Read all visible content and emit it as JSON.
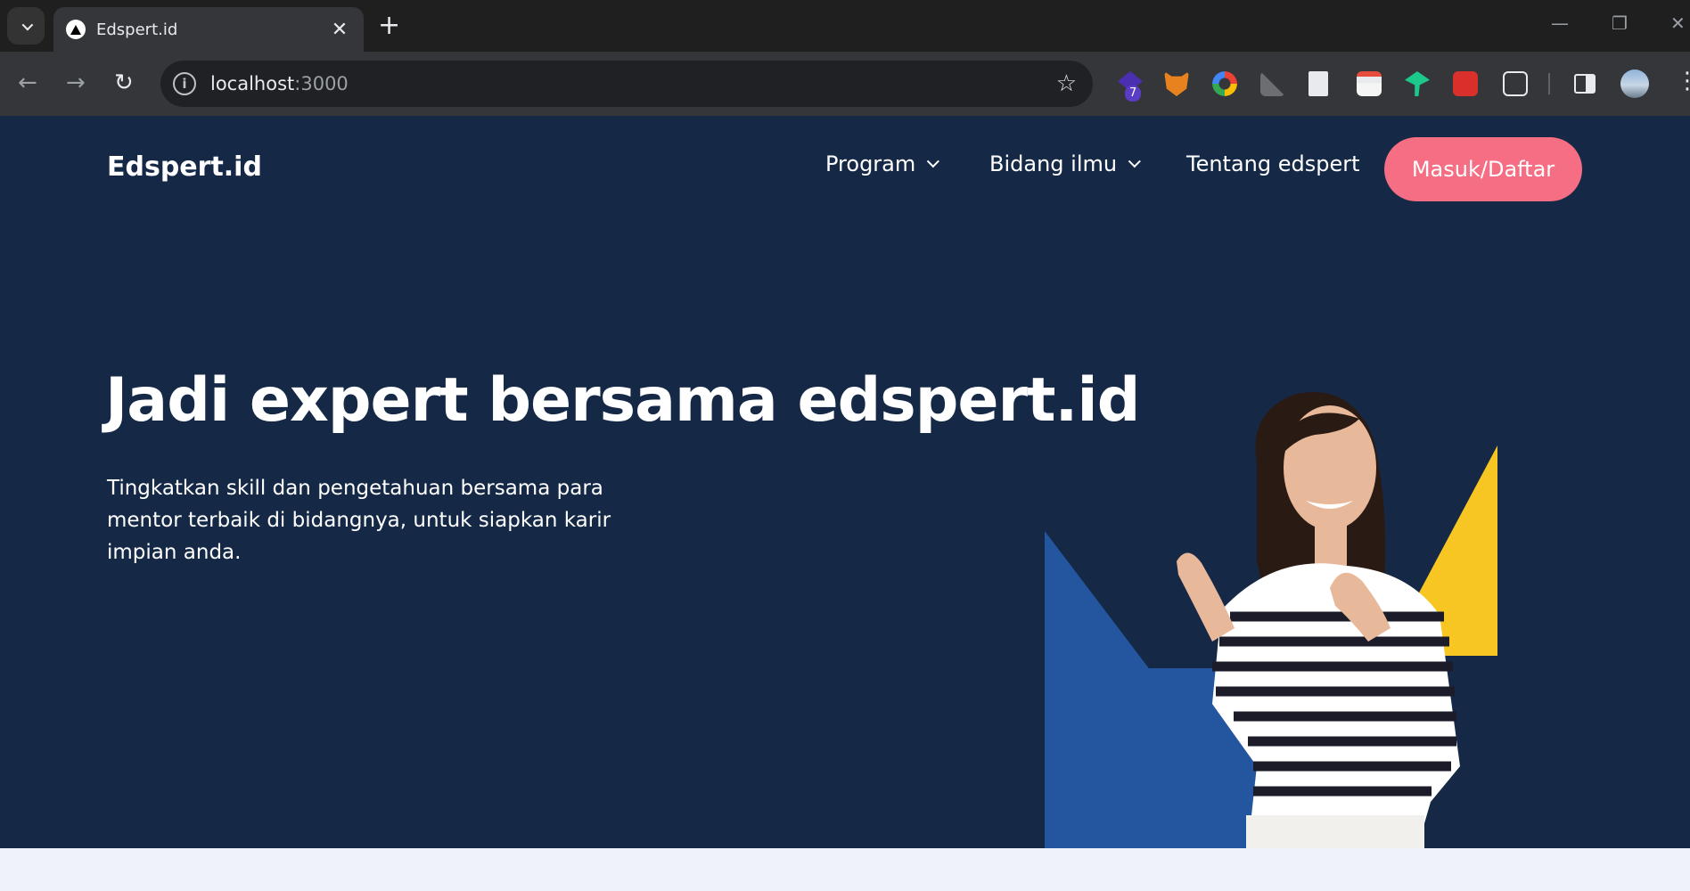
{
  "browser": {
    "tab_title": "Edspert.id",
    "url_host": "localhost",
    "url_port": ":3000",
    "extension_badge": "7"
  },
  "site": {
    "logo": "Edspert.id",
    "nav": [
      "Program",
      "Bidang ilmu",
      "Tentang edspert"
    ],
    "cta": "Masuk/Daftar",
    "hero_title": "Jadi expert bersama edspert.id",
    "hero_sub": "Tingkatkan skill dan pengetahuan bersama para mentor terbaik di bidangnya, untuk siapkan karir impian anda."
  },
  "colors": {
    "page_bg": "#152947",
    "cta_bg": "#f56e84",
    "blue_shape": "#2456a0",
    "yellow_shape": "#f8c623"
  }
}
